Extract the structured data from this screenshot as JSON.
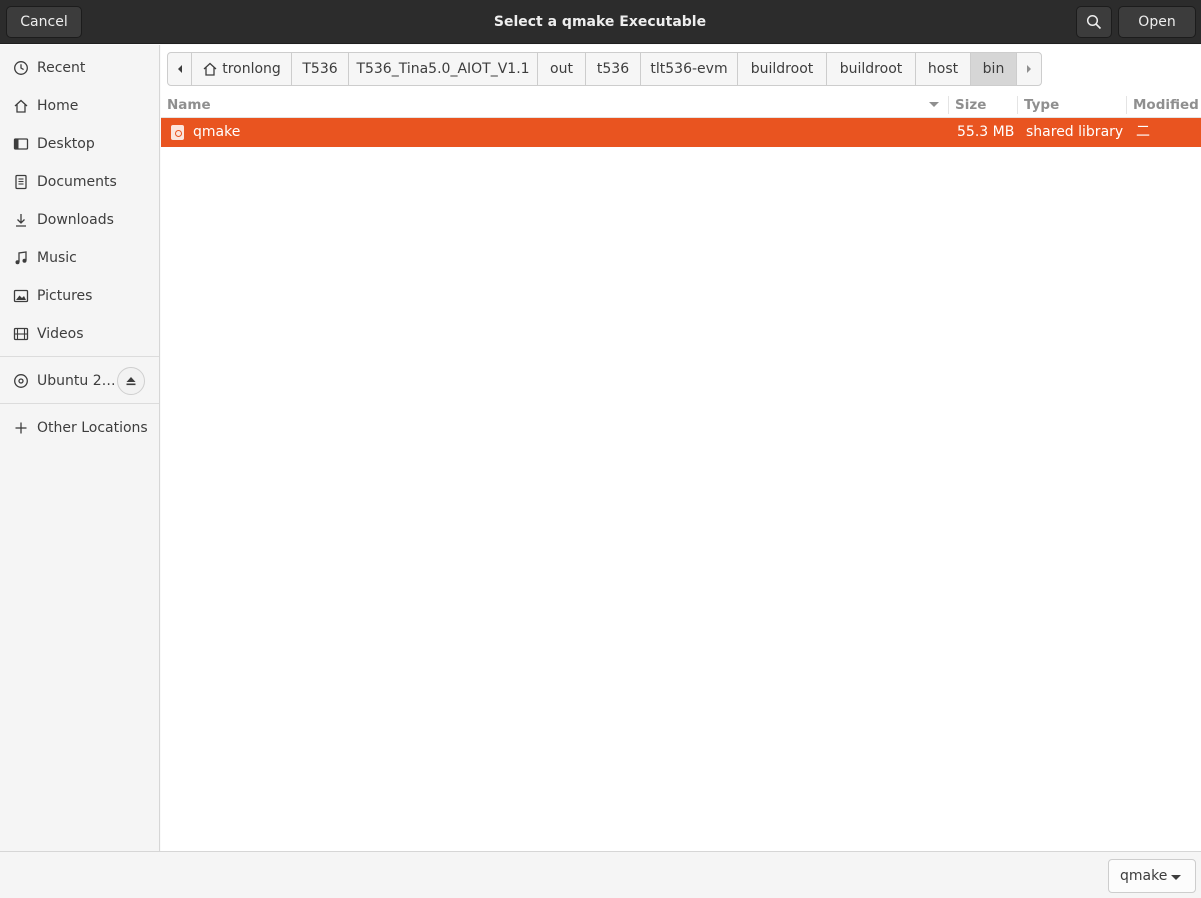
{
  "dialog": {
    "title": "Select a qmake Executable",
    "cancel_label": "Cancel",
    "open_label": "Open"
  },
  "sidebar": {
    "items": [
      {
        "label": "Recent",
        "icon": "clock-icon"
      },
      {
        "label": "Home",
        "icon": "home-icon"
      },
      {
        "label": "Desktop",
        "icon": "desktop-icon"
      },
      {
        "label": "Documents",
        "icon": "document-icon"
      },
      {
        "label": "Downloads",
        "icon": "download-icon"
      },
      {
        "label": "Music",
        "icon": "music-icon"
      },
      {
        "label": "Pictures",
        "icon": "picture-icon"
      },
      {
        "label": "Videos",
        "icon": "video-icon"
      }
    ],
    "device": {
      "label": "Ubuntu 2…",
      "icon": "disc-icon"
    },
    "other": {
      "label": "Other Locations",
      "icon": "plus-icon"
    }
  },
  "pathbar": {
    "segments": [
      "tronlong",
      "T536",
      "T536_Tina5.0_AIOT_V1.1",
      "out",
      "t536",
      "tlt536-evm",
      "buildroot",
      "buildroot",
      "host",
      "bin"
    ],
    "active_index": 9
  },
  "columns": {
    "name": "Name",
    "size": "Size",
    "type": "Type",
    "modified": "Modified"
  },
  "files": [
    {
      "name": "qmake",
      "size": "55.3 MB",
      "type": "shared library",
      "modified": "二"
    }
  ],
  "footer": {
    "filter_value": "qmake"
  },
  "colors": {
    "accent": "#e95420",
    "headerbar": "#2c2c2c"
  }
}
